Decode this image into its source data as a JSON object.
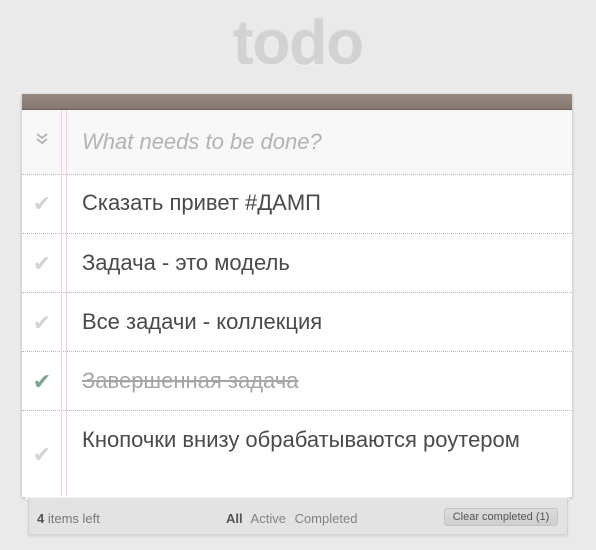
{
  "app": {
    "title": "todo"
  },
  "new_todo": {
    "placeholder": "What needs to be done?",
    "value": ""
  },
  "todos": [
    {
      "text": "Сказать привет #ДАМП",
      "completed": false
    },
    {
      "text": "Задача - это модель",
      "completed": false
    },
    {
      "text": "Все задачи - коллекция",
      "completed": false
    },
    {
      "text": "Завершенная задача",
      "completed": true
    },
    {
      "text": "Кнопочки внизу обрабатываются роутером",
      "completed": false
    }
  ],
  "footer": {
    "count": "4",
    "count_suffix": "items left",
    "filters": [
      "All",
      "Active",
      "Completed"
    ],
    "selected_filter": "All",
    "clear_label": "Clear completed (1)"
  },
  "icons": {
    "toggle_all": "double-chevron-down-icon",
    "check": "checkmark-icon"
  },
  "colors": {
    "header_bar": "#8c7f76",
    "completed_check": "#7ba88c",
    "pending_check": "#d4d4d4"
  }
}
